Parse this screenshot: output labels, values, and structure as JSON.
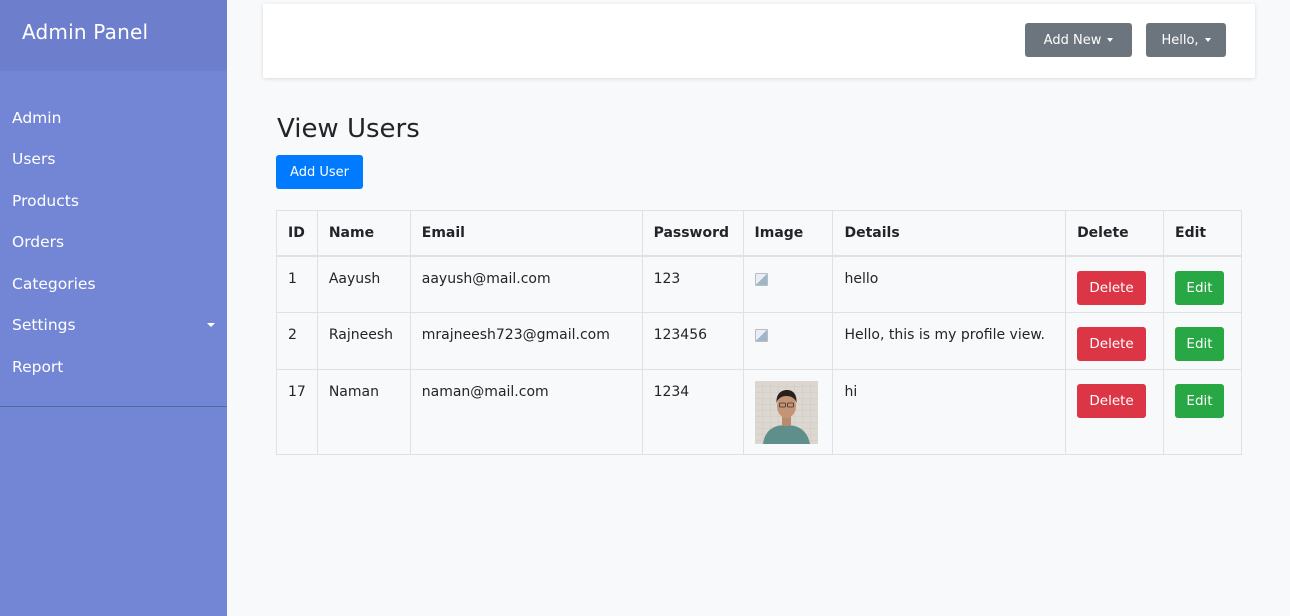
{
  "sidebar": {
    "title": "Admin Panel",
    "items": [
      {
        "label": "Admin"
      },
      {
        "label": "Users"
      },
      {
        "label": "Products"
      },
      {
        "label": "Orders"
      },
      {
        "label": "Categories"
      },
      {
        "label": "Settings",
        "has_dropdown": true
      },
      {
        "label": "Report"
      }
    ]
  },
  "topbar": {
    "add_new_label": "Add New",
    "hello_label": "Hello,"
  },
  "main": {
    "title": "View Users",
    "add_user_label": "Add User",
    "table": {
      "headers": [
        "ID",
        "Name",
        "Email",
        "Password",
        "Image",
        "Details",
        "Delete",
        "Edit"
      ],
      "rows": [
        {
          "id": "1",
          "name": "Aayush",
          "email": "aayush@mail.com",
          "password": "123",
          "image": "broken",
          "details": "hello",
          "delete": "Delete",
          "edit": "Edit"
        },
        {
          "id": "2",
          "name": "Rajneesh",
          "email": "mrajneesh723@gmail.com",
          "password": "123456",
          "image": "broken",
          "details": "Hello, this is my profile view.",
          "delete": "Delete",
          "edit": "Edit"
        },
        {
          "id": "17",
          "name": "Naman",
          "email": "naman@mail.com",
          "password": "1234",
          "image": "photo",
          "details": "hi",
          "delete": "Delete",
          "edit": "Edit"
        }
      ]
    }
  },
  "colors": {
    "sidebar_bg": "#7386d5",
    "sidebar_header_bg": "#6d7fcc",
    "primary": "#007bff",
    "danger": "#dc3545",
    "success": "#28a745",
    "secondary": "#6c757d"
  }
}
